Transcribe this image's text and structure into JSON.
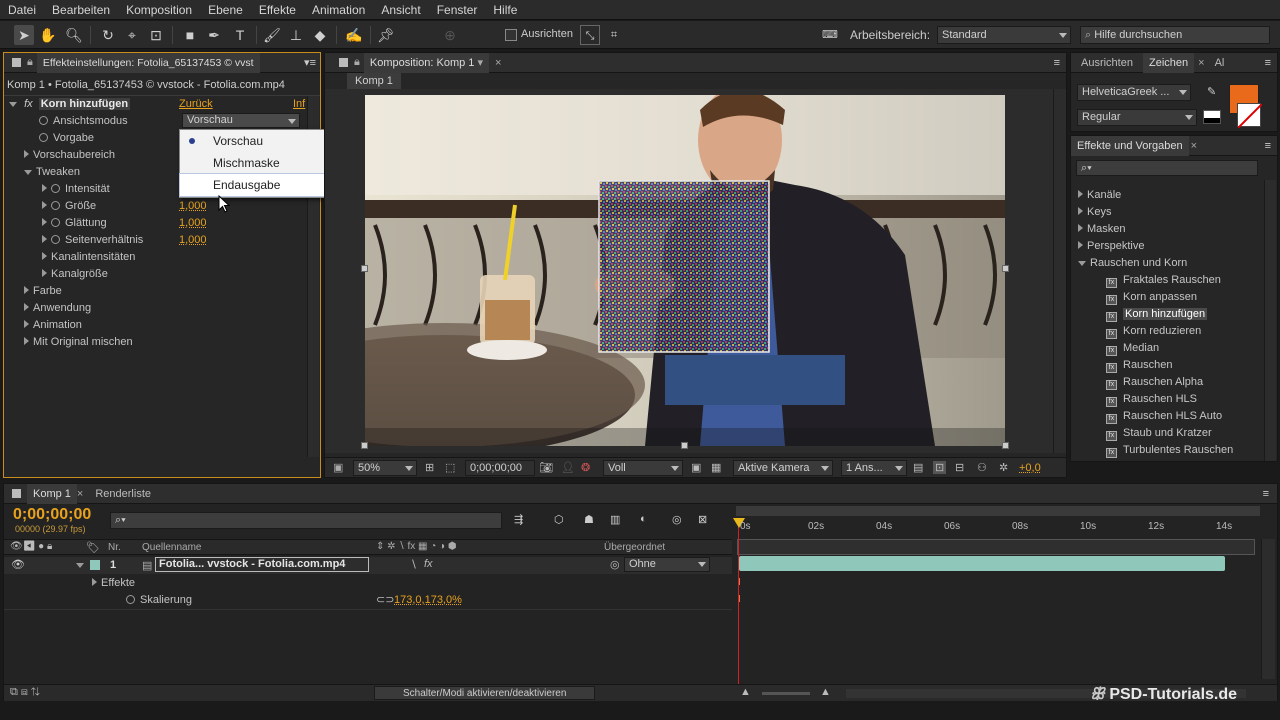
{
  "menu": [
    "Datei",
    "Bearbeiten",
    "Komposition",
    "Ebene",
    "Effekte",
    "Animation",
    "Ansicht",
    "Fenster",
    "Hilfe"
  ],
  "toolbar": {
    "align_label": "Ausrichten",
    "workspace_label": "Arbeitsbereich:",
    "workspace_value": "Standard",
    "help_placeholder": "Hilfe durchsuchen"
  },
  "effects_panel": {
    "tab_title": "Effekteinstellungen: Fotolia_65137453 © vvst",
    "breadcrumb": "Komp 1 • Fotolia_65137453 © vvstock - Fotolia.com.mp4",
    "effect_name": "Korn hinzufügen",
    "reset": "Zurück",
    "info": "Inf",
    "rows": {
      "ansichtsmodus": "Ansichtsmodus",
      "ansichtsmodus_value": "Vorschau",
      "vorgabe": "Vorgabe",
      "vorschaubereich": "Vorschaubereich",
      "tweaken": "Tweaken",
      "intensitaet": "Intensität",
      "groesse": "Größe",
      "groesse_value": "1,000",
      "glaettung": "Glättung",
      "glaettung_value": "1,000",
      "seitenverhaeltnis": "Seitenverhältnis",
      "seitenverhaeltnis_value": "1,000",
      "kanalintensitaeten": "Kanalintensitäten",
      "kanalgroesse": "Kanalgröße",
      "farbe": "Farbe",
      "anwendung": "Anwendung",
      "animation": "Animation",
      "mit_original": "Mit Original mischen"
    },
    "dropdown": {
      "items": [
        "Vorschau",
        "Mischmaske",
        "Endausgabe"
      ],
      "selected": "Vorschau",
      "hovered": "Endausgabe"
    }
  },
  "comp_panel": {
    "tab_title": "Komposition: Komp 1",
    "subtab": "Komp 1",
    "zoom": "50%",
    "timecode": "0;00;00;00",
    "quality": "Voll",
    "camera": "Aktive Kamera",
    "views": "1 Ans...",
    "exposure": "+0,0"
  },
  "right_panel": {
    "tabs": [
      "Ausrichten",
      "Zeichen",
      "Al"
    ],
    "font": "HelveticaGreek ...",
    "style": "Regular",
    "fill_color": "#e86a1a",
    "effects_tab": "Effekte und Vorgaben",
    "tree": [
      {
        "label": "Kanäle",
        "type": "folder"
      },
      {
        "label": "Keys",
        "type": "folder"
      },
      {
        "label": "Masken",
        "type": "folder"
      },
      {
        "label": "Perspektive",
        "type": "folder"
      },
      {
        "label": "Rauschen und Korn",
        "type": "folder-open"
      },
      {
        "label": "Fraktales Rauschen",
        "type": "fx"
      },
      {
        "label": "Korn anpassen",
        "type": "fx"
      },
      {
        "label": "Korn hinzufügen",
        "type": "fx",
        "selected": true
      },
      {
        "label": "Korn reduzieren",
        "type": "fx"
      },
      {
        "label": "Median",
        "type": "fx"
      },
      {
        "label": "Rauschen",
        "type": "fx"
      },
      {
        "label": "Rauschen Alpha",
        "type": "fx"
      },
      {
        "label": "Rauschen HLS",
        "type": "fx"
      },
      {
        "label": "Rauschen HLS Auto",
        "type": "fx"
      },
      {
        "label": "Staub und Kratzer",
        "type": "fx"
      },
      {
        "label": "Turbulentes Rauschen",
        "type": "fx"
      }
    ]
  },
  "timeline": {
    "tabs": [
      "Komp 1",
      "Renderliste"
    ],
    "timecode": "0;00;00;00",
    "fps": "00000 (29.97 fps)",
    "col_nr": "Nr.",
    "col_source": "Quellenname",
    "col_parent": "Übergeordnet",
    "layer_num": "1",
    "layer_name": "Fotolia... vvstock - Fotolia.com.mp4",
    "parent_value": "Ohne",
    "effekte": "Effekte",
    "skalierung": "Skalierung",
    "skalierung_value": "173,0,173,0%",
    "ticks": [
      "0s",
      "02s",
      "04s",
      "06s",
      "08s",
      "10s",
      "12s",
      "14s"
    ],
    "toggle_label": "Schalter/Modi aktivieren/deaktivieren"
  },
  "watermark": "PSD-Tutorials.de"
}
